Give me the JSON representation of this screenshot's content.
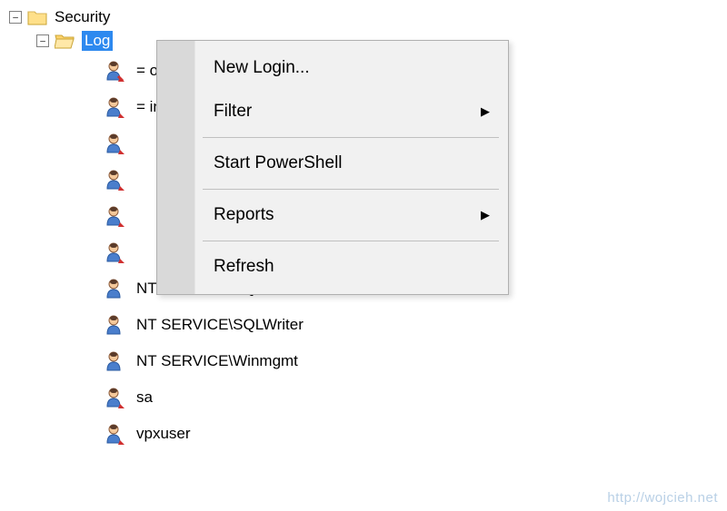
{
  "tree": {
    "security_label": "Security",
    "logins_label": "Log",
    "logins": [
      "=                                   ogin##",
      "=                                in##",
      "",
      "",
      "",
      "",
      "NT SERVICE\\SQLSERVERAGENT",
      "NT SERVICE\\SQLWriter",
      "NT SERVICE\\Winmgmt",
      "sa",
      "vpxuser"
    ]
  },
  "menu": {
    "new_login": "New Login...",
    "filter": "Filter",
    "start_powershell": "Start PowerShell",
    "reports": "Reports",
    "refresh": "Refresh"
  },
  "watermark": "http://wojcieh.net",
  "glyphs": {
    "minus": "−",
    "arrow": "▶"
  }
}
